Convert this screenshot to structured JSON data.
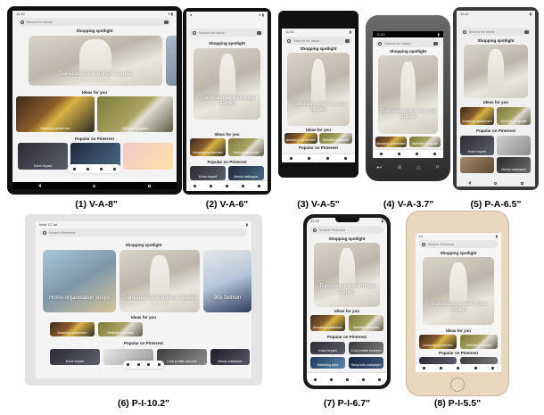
{
  "app": {
    "search_placeholder": "Search for ideas",
    "search_placeholder_ios": "Search Pinterest",
    "spotlight_heading": "Shopping spotlight",
    "spotlight_title": "Transeasonal wardrobe staples",
    "ideas_heading": "Ideas for you",
    "popular_heading": "Popular on Pinterest",
    "idea_1": "Amazing spidermen",
    "idea_2": "Website template",
    "pop_1": "Kobe bryant",
    "pop_2": "Nerdy wallpaper",
    "pop_3": "Cool profile pictures",
    "pop_4": "Matching pfps",
    "pop_5": "Stray kids wallpaper",
    "ipad_spot_left": "Home organisation shops",
    "ipad_spot_right": "90s fashion",
    "ipad_pop_2": "Cool profile pictures",
    "status_time": "12:23",
    "status_time_android": "11:42",
    "ipad_status": "Wed 12 Jul"
  },
  "captions": [
    "(1) V-A-8\"",
    "(2) V-A-6\"",
    "(3) V-A-5\"",
    "(4) V-A-3.7\"",
    "(5) P-A-6.5\"",
    "(6) P-I-10.2\"",
    "(7) P-I-6.7\"",
    "(8) P-I-5.5\""
  ],
  "colors": {
    "bezel": "#111111",
    "tabbar": "#ffffff",
    "gold_frame": "#e9d7c0"
  }
}
